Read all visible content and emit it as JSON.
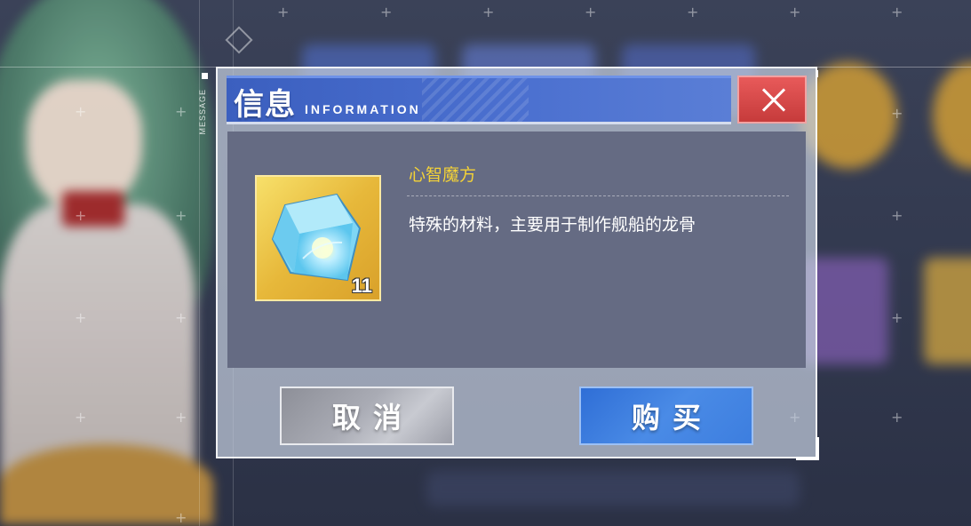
{
  "side_label": "MESSAGE",
  "dialog": {
    "title": "信息",
    "subtitle": "INFORMATION",
    "close_icon": "close-x-icon"
  },
  "item": {
    "name": "心智魔方",
    "description": "特殊的材料，主要用于制作舰船的龙骨",
    "count": "11",
    "icon": "mind-cube-icon",
    "frame_color": "#f0c94a"
  },
  "buttons": {
    "cancel": "取消",
    "buy": "购买"
  },
  "colors": {
    "title_bar": "#4a6fcf",
    "close": "#d94a4a",
    "item_name": "#f4d237",
    "buy_button": "#3d7edf",
    "cancel_button": "#a9abb4"
  }
}
